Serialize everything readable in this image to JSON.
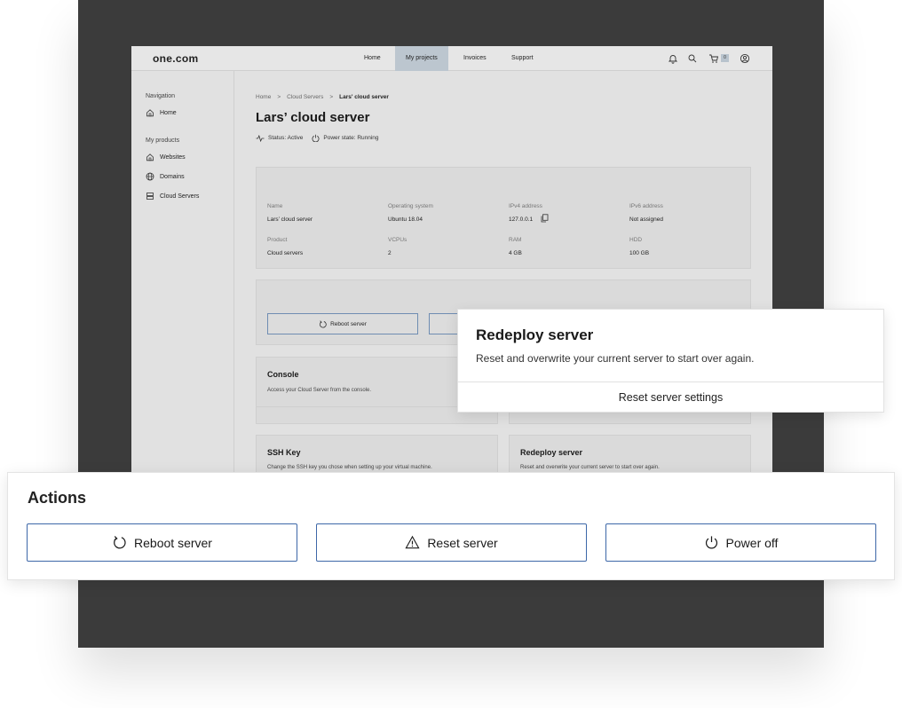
{
  "app": {
    "logo": "one.com",
    "nav": [
      "Home",
      "My projects",
      "Invoices",
      "Support"
    ],
    "active_nav": "My projects",
    "cart_count": "0"
  },
  "sidebar": {
    "navigation_heading": "Navigation",
    "home": "Home",
    "products_heading": "My products",
    "items": [
      "Websites",
      "Domains",
      "Cloud Servers"
    ]
  },
  "breadcrumb": [
    "Home",
    ">",
    "Cloud Servers",
    ">",
    "Lars' cloud server"
  ],
  "page": {
    "title": "Lars’ cloud server",
    "status": "Status: Active",
    "power_state": "Power state: Running"
  },
  "server_info": {
    "labels": [
      "Name",
      "Operating system",
      "IPv4 address",
      "IPv6 address",
      "Product",
      "VCPUs",
      "RAM",
      "HDD"
    ],
    "values": [
      "Lars’ cloud server",
      "Ubuntu 18.04",
      "127.0.0.1",
      "Not assigned",
      "Cloud servers",
      "2",
      "4 GB",
      "100 GB"
    ]
  },
  "inner_actions": {
    "reboot_label": "Reboot server"
  },
  "cards": {
    "console_title": "Console",
    "console_desc": "Access your Cloud Server from the console.",
    "ssh_title": "SSH Key",
    "ssh_desc": "Change the SSH key you chose when setting up your virtual machine.",
    "redeploy_title": "Redeploy server",
    "redeploy_desc": "Reset and overwrite your current server to start over again."
  },
  "popup": {
    "title": "Redeploy server",
    "description": "Reset and overwrite your current server to start over again.",
    "action": "Reset server settings"
  },
  "actions": {
    "title": "Actions",
    "reboot": "Reboot server",
    "reset": "Reset server",
    "power_off": "Power off"
  },
  "icons": [
    "bell-icon",
    "search-icon",
    "cart-icon",
    "user-icon",
    "home-icon",
    "globe-icon",
    "server-icon",
    "activity-icon",
    "power-icon",
    "copy-icon",
    "reboot-icon",
    "warning-icon"
  ],
  "colors": {
    "accent": "#3d67a8",
    "active_nav_bg": "#bcc6cf",
    "frame": "#3b3b3b"
  }
}
